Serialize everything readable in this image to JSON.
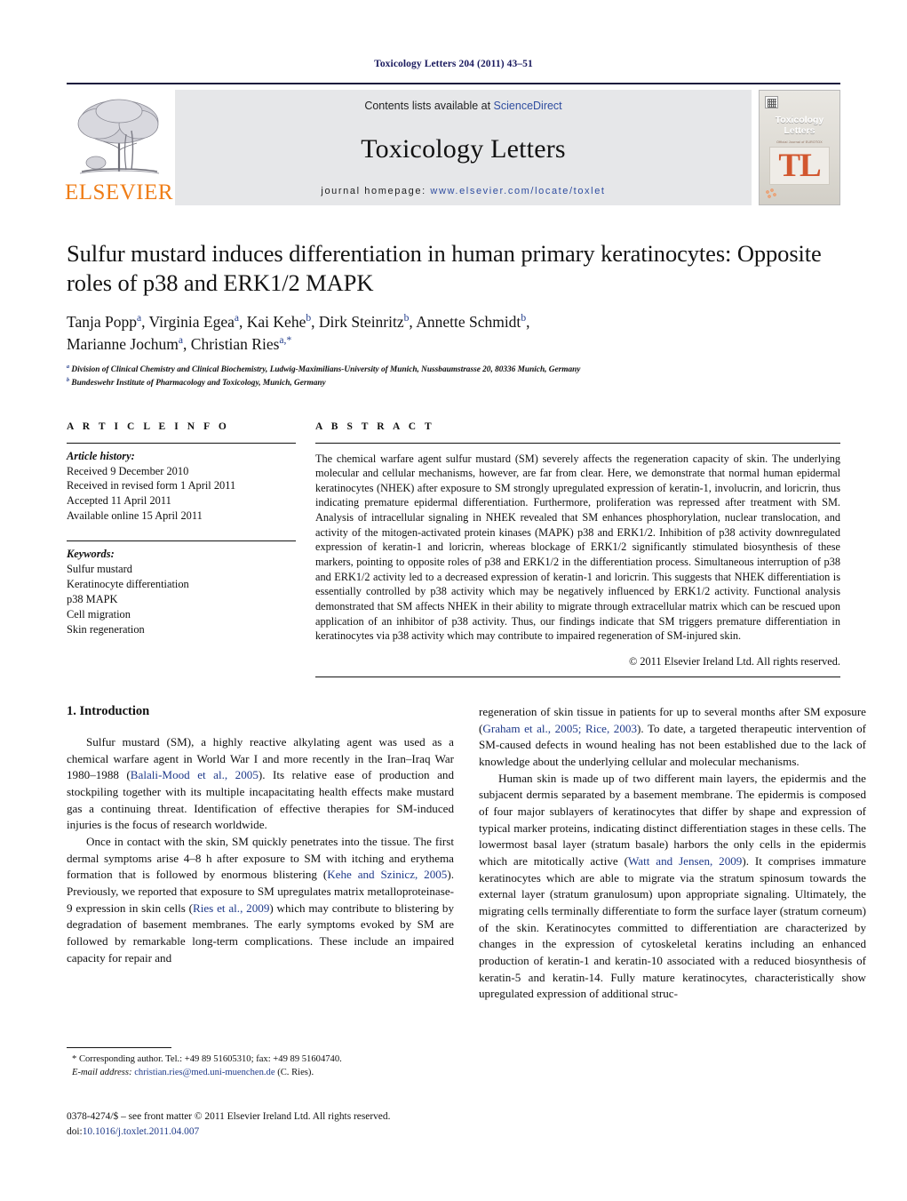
{
  "running_head": "Toxicology Letters 204 (2011) 43–51",
  "masthead": {
    "publisher_name": "ELSEVIER",
    "contents_prefix": "Contents lists available at ",
    "contents_link": "ScienceDirect",
    "journal_name": "Toxicology Letters",
    "homepage_prefix": "journal homepage: ",
    "homepage_url": "www.elsevier.com/locate/toxlet",
    "cover": {
      "title_line1": "Toxicology",
      "title_line2": "Letters",
      "subtitle": "Official Journal of EUROTOX",
      "logo": "TL"
    },
    "accent_orange": "#ef7d17",
    "link_blue": "#2f4da0"
  },
  "article": {
    "title": "Sulfur mustard induces differentiation in human primary keratinocytes: Opposite roles of p38 and ERK1/2 MAPK",
    "authors_line1": "Tanja Popp a, Virginia Egea a, Kai Kehe b, Dirk Steinritz b, Annette Schmidt b,",
    "authors_line2": "Marianne Jochum a, Christian Ries a,*",
    "affiliations": [
      "a Division of Clinical Chemistry and Clinical Biochemistry, Ludwig-Maximilians-University of Munich, Nussbaumstrasse 20, 80336 Munich, Germany",
      "b Bundeswehr Institute of Pharmacology and Toxicology, Munich, Germany"
    ]
  },
  "article_info": {
    "heading": "A R T I C L E   I N F O",
    "history_label": "Article history:",
    "history": [
      "Received 9 December 2010",
      "Received in revised form 1 April 2011",
      "Accepted 11 April 2011",
      "Available online 15 April 2011"
    ],
    "keywords_label": "Keywords:",
    "keywords": [
      "Sulfur mustard",
      "Keratinocyte differentiation",
      "p38 MAPK",
      "Cell migration",
      "Skin regeneration"
    ]
  },
  "abstract": {
    "heading": "A B S T R A C T",
    "text": "The chemical warfare agent sulfur mustard (SM) severely affects the regeneration capacity of skin. The underlying molecular and cellular mechanisms, however, are far from clear. Here, we demonstrate that normal human epidermal keratinocytes (NHEK) after exposure to SM strongly upregulated expression of keratin-1, involucrin, and loricrin, thus indicating premature epidermal differentiation. Furthermore, proliferation was repressed after treatment with SM. Analysis of intracellular signaling in NHEK revealed that SM enhances phosphorylation, nuclear translocation, and activity of the mitogen-activated protein kinases (MAPK) p38 and ERK1/2. Inhibition of p38 activity downregulated expression of keratin-1 and loricrin, whereas blockage of ERK1/2 significantly stimulated biosynthesis of these markers, pointing to opposite roles of p38 and ERK1/2 in the differentiation process. Simultaneous interruption of p38 and ERK1/2 activity led to a decreased expression of keratin-1 and loricrin. This suggests that NHEK differentiation is essentially controlled by p38 activity which may be negatively influenced by ERK1/2 activity. Functional analysis demonstrated that SM affects NHEK in their ability to migrate through extracellular matrix which can be rescued upon application of an inhibitor of p38 activity. Thus, our findings indicate that SM triggers premature differentiation in keratinocytes via p38 activity which may contribute to impaired regeneration of SM-injured skin.",
    "copyright": "© 2011 Elsevier Ireland Ltd. All rights reserved."
  },
  "introduction": {
    "heading": "1.  Introduction",
    "left_paragraphs": [
      {
        "parts": [
          {
            "t": "Sulfur mustard (SM), a highly reactive alkylating agent was used as a chemical warfare agent in World War I and more recently in the Iran–Iraq War 1980–1988 (",
            "k": "text"
          },
          {
            "t": "Balali-Mood et al., 2005",
            "k": "cite"
          },
          {
            "t": "). Its relative ease of production and stockpiling together with its multiple incapacitating health effects make mustard gas a continuing threat. Identification of effective therapies for SM-induced injuries is the focus of research worldwide.",
            "k": "text"
          }
        ]
      },
      {
        "parts": [
          {
            "t": "Once in contact with the skin, SM quickly penetrates into the tissue. The first dermal symptoms arise 4–8 h after exposure to SM with itching and erythema formation that is followed by enormous blistering (",
            "k": "text"
          },
          {
            "t": "Kehe and Szinicz, 2005",
            "k": "cite"
          },
          {
            "t": "). Previously, we reported that exposure to SM upregulates matrix metalloproteinase-9 expression in skin cells (",
            "k": "text"
          },
          {
            "t": "Ries et al., 2009",
            "k": "cite"
          },
          {
            "t": ") which may contribute to blistering by degradation of basement membranes. The early symptoms evoked by SM are followed by remarkable long-term complications. These include an impaired capacity for repair and",
            "k": "text"
          }
        ]
      }
    ],
    "right_paragraphs": [
      {
        "parts": [
          {
            "t": "regeneration of skin tissue in patients for up to several months after SM exposure (",
            "k": "text"
          },
          {
            "t": "Graham et al., 2005; Rice, 2003",
            "k": "cite"
          },
          {
            "t": "). To date, a targeted therapeutic intervention of SM-caused defects in wound healing has not been established due to the lack of knowledge about the underlying cellular and molecular mechanisms.",
            "k": "text"
          }
        ],
        "continued": true
      },
      {
        "parts": [
          {
            "t": "Human skin is made up of two different main layers, the epidermis and the subjacent dermis separated by a basement membrane. The epidermis is composed of four major sublayers of keratinocytes that differ by shape and expression of typical marker proteins, indicating distinct differentiation stages in these cells. The lowermost basal layer (stratum basale) harbors the only cells in the epidermis which are mitotically active (",
            "k": "text"
          },
          {
            "t": "Watt and Jensen, 2009",
            "k": "cite"
          },
          {
            "t": "). It comprises immature keratinocytes which are able to migrate via the stratum spinosum towards the external layer (stratum granulosum) upon appropriate signaling. Ultimately, the migrating cells terminally differentiate to form the surface layer (stratum corneum) of the skin. Keratinocytes committed to differentiation are characterized by changes in the expression of cytoskeletal keratins including an enhanced production of keratin-1 and keratin-10 associated with a reduced biosynthesis of keratin-5 and keratin-14. Fully mature keratinocytes, characteristically show upregulated expression of additional struc-",
            "k": "text"
          }
        ]
      }
    ]
  },
  "footnotes": {
    "corresponding": "* Corresponding author. Tel.: +49 89 51605310; fax: +49 89 51604740.",
    "email_label": "E-mail address:",
    "email": "christian.ries@med.uni-muenchen.de",
    "email_suffix": " (C. Ries).",
    "issn_line": "0378-4274/$ – see front matter © 2011 Elsevier Ireland Ltd. All rights reserved.",
    "doi_prefix": "doi:",
    "doi": "10.1016/j.toxlet.2011.04.007"
  }
}
